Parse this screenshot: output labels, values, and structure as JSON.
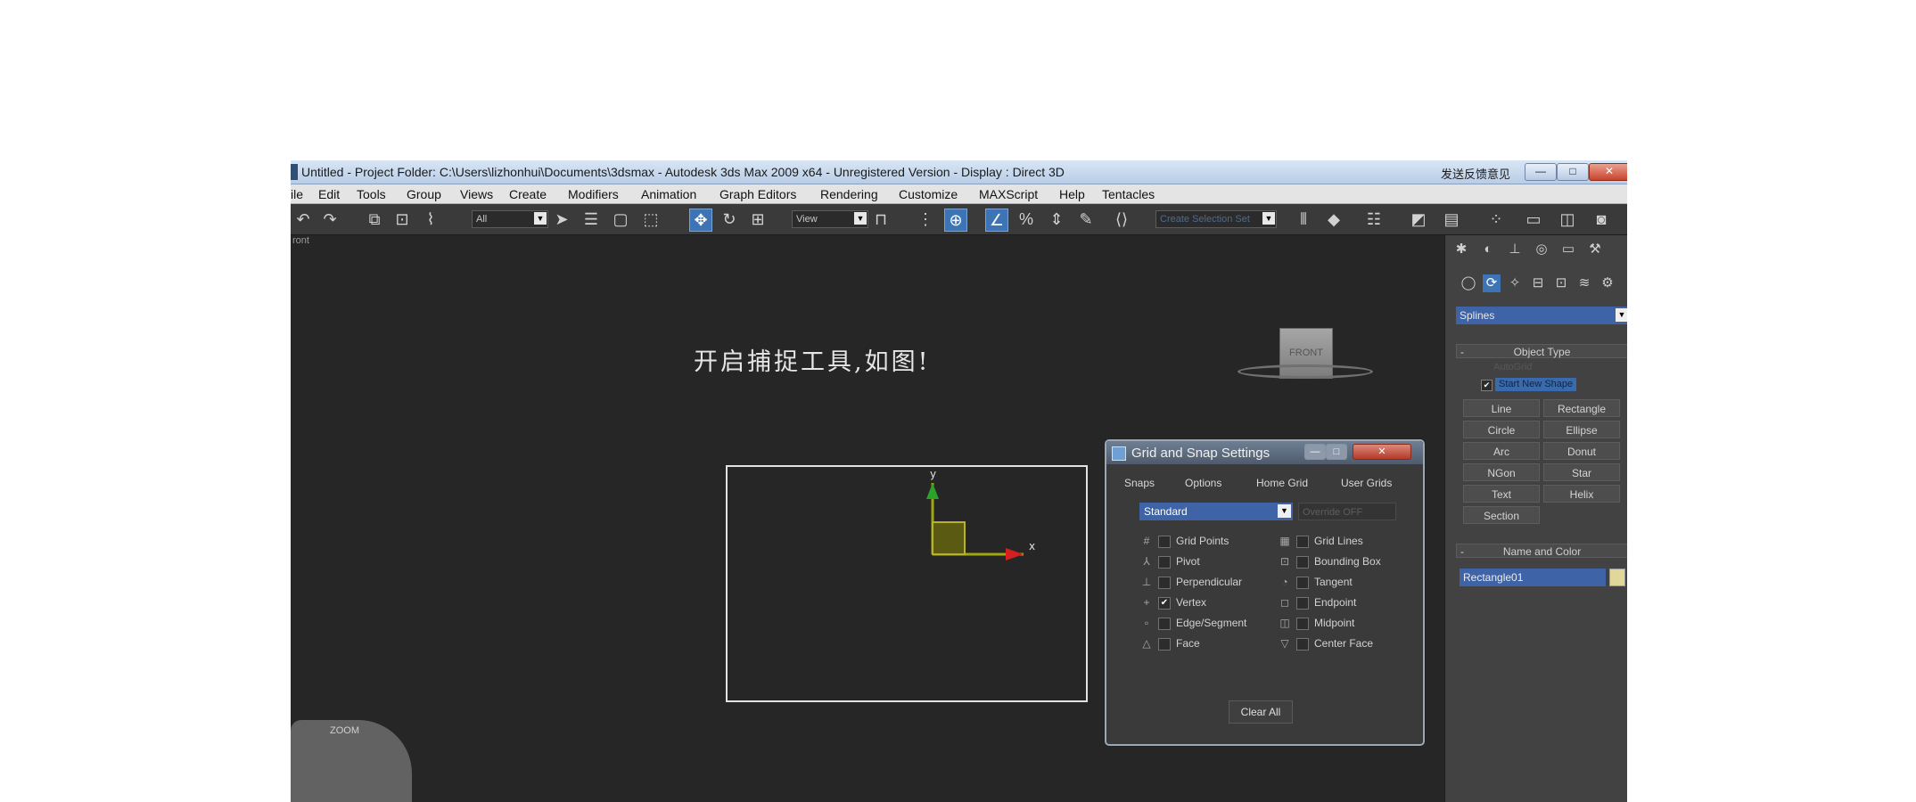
{
  "window": {
    "title": "Untitled      - Project Folder: C:\\Users\\lizhonhui\\Documents\\3dsmax      - Autodesk 3ds Max  2009 x64   - Unregistered Version      - Display : Direct 3D",
    "feedback_link": "发送反馈意见",
    "minimize_glyph": "—",
    "maximize_glyph": "□",
    "close_glyph": "✕"
  },
  "menu": [
    "ile",
    "Edit",
    "Tools",
    "Group",
    "Views",
    "Create",
    "Modifiers",
    "Animation",
    "Graph Editors",
    "Rendering",
    "Customize",
    "MAXScript",
    "Help",
    "Tentacles"
  ],
  "toolbar": {
    "selection_filter": "All",
    "reference_coord": "View",
    "named_selection": "Create Selection Set"
  },
  "viewport": {
    "label": "ront",
    "annotation": "开启捕捉工具,如图!",
    "axis_x": "x",
    "axis_y": "y",
    "viewcube_label": "FRONT",
    "steering_label": "ZOOM"
  },
  "snap_dialog": {
    "title": "Grid and Snap Settings",
    "tabs": [
      "Snaps",
      "Options",
      "Home Grid",
      "User Grids"
    ],
    "snap_type": "Standard",
    "override": "Override OFF",
    "left_options": [
      {
        "label": "Grid Points",
        "checked": false,
        "icon": "grid-points-icon"
      },
      {
        "label": "Pivot",
        "checked": false,
        "icon": "pivot-icon"
      },
      {
        "label": "Perpendicular",
        "checked": false,
        "icon": "perpendicular-icon"
      },
      {
        "label": "Vertex",
        "checked": true,
        "icon": "vertex-icon"
      },
      {
        "label": "Edge/Segment",
        "checked": false,
        "icon": "edge-segment-icon"
      },
      {
        "label": "Face",
        "checked": false,
        "icon": "face-icon"
      }
    ],
    "right_options": [
      {
        "label": "Grid Lines",
        "checked": false,
        "icon": "grid-lines-icon"
      },
      {
        "label": "Bounding Box",
        "checked": false,
        "icon": "bounding-box-icon"
      },
      {
        "label": "Tangent",
        "checked": false,
        "icon": "tangent-icon"
      },
      {
        "label": "Endpoint",
        "checked": false,
        "icon": "endpoint-icon"
      },
      {
        "label": "Midpoint",
        "checked": false,
        "icon": "midpoint-icon"
      },
      {
        "label": "Center Face",
        "checked": false,
        "icon": "center-face-icon"
      }
    ],
    "clear_all": "Clear All"
  },
  "command_panel": {
    "category": "Splines",
    "object_type_header": "Object Type",
    "autogrid": "AutoGrid",
    "start_new_shape": "Start New Shape",
    "buttons": [
      "Line",
      "Rectangle",
      "Circle",
      "Ellipse",
      "Arc",
      "Donut",
      "NGon",
      "Star",
      "Text",
      "Helix",
      "Section"
    ],
    "name_color_header": "Name and Color",
    "object_name": "Rectangle01",
    "object_color": "#e1d79b"
  }
}
